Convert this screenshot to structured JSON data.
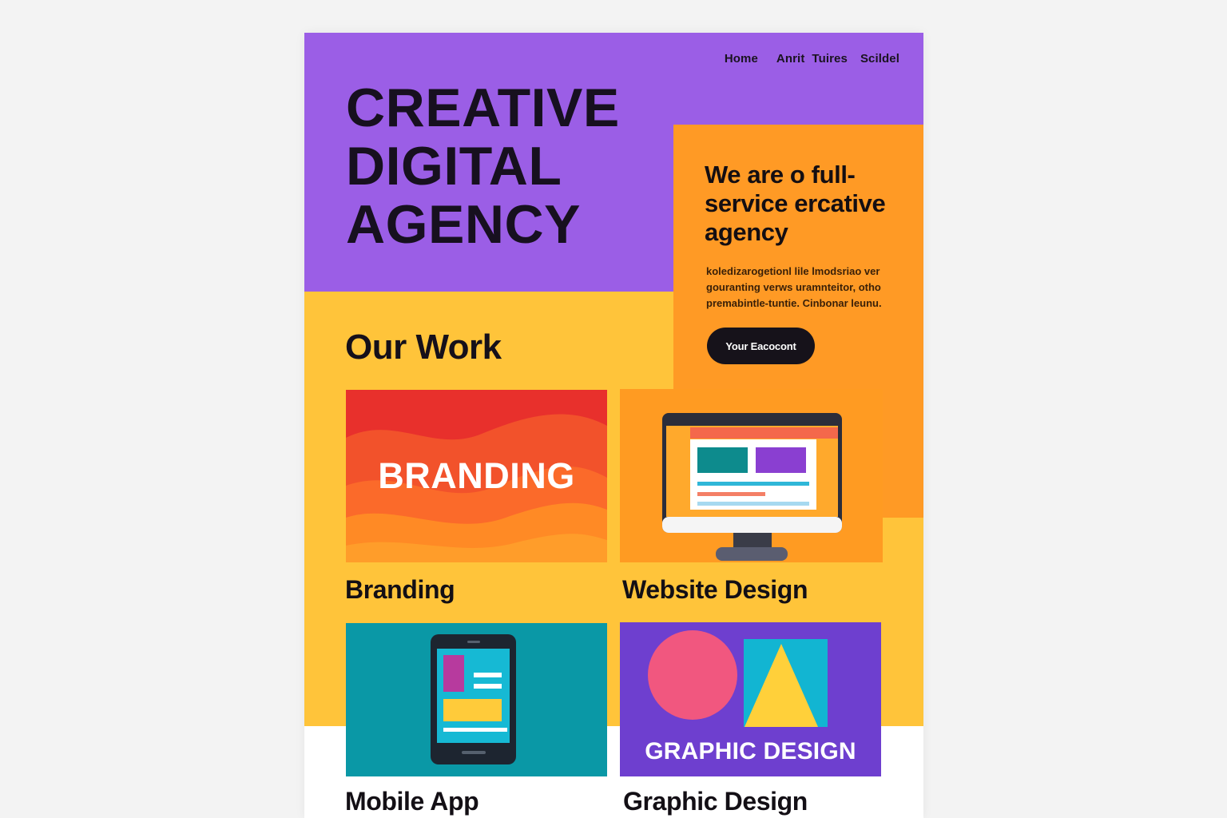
{
  "nav": {
    "items": [
      {
        "label": "Home"
      },
      {
        "label": "Anrit"
      },
      {
        "label": "Tuires"
      },
      {
        "label": "Scildel"
      }
    ]
  },
  "hero": {
    "title_lines": [
      "CREATIVE",
      "DIGITAL",
      "AGENCY"
    ]
  },
  "intro": {
    "heading": "We are o full-service ercative agency",
    "body": "koledizarogetionl lile lmodsriao ver gouranting verws uramnteitor, otho premabintle-tuntie. Cinbonar leunu.",
    "cta_label": "Your Eacocont"
  },
  "work": {
    "title": "Our Work",
    "cards": [
      {
        "label": "Branding",
        "image_text": "BRANDING"
      },
      {
        "label": "Website Design"
      },
      {
        "label": "Mobile App"
      },
      {
        "label": "Graphic Design",
        "image_text": "GRAPHIC DESIGN"
      }
    ]
  },
  "colors": {
    "purple": "#9b5ee6",
    "orange": "#ff9a25",
    "yellow": "#ffc43a",
    "teal": "#0a98a6",
    "deep_purple": "#6e3fcf",
    "dark": "#16121a"
  },
  "icons": [
    "monitor-icon",
    "tablet-icon",
    "circle-shape",
    "triangle-shape"
  ]
}
